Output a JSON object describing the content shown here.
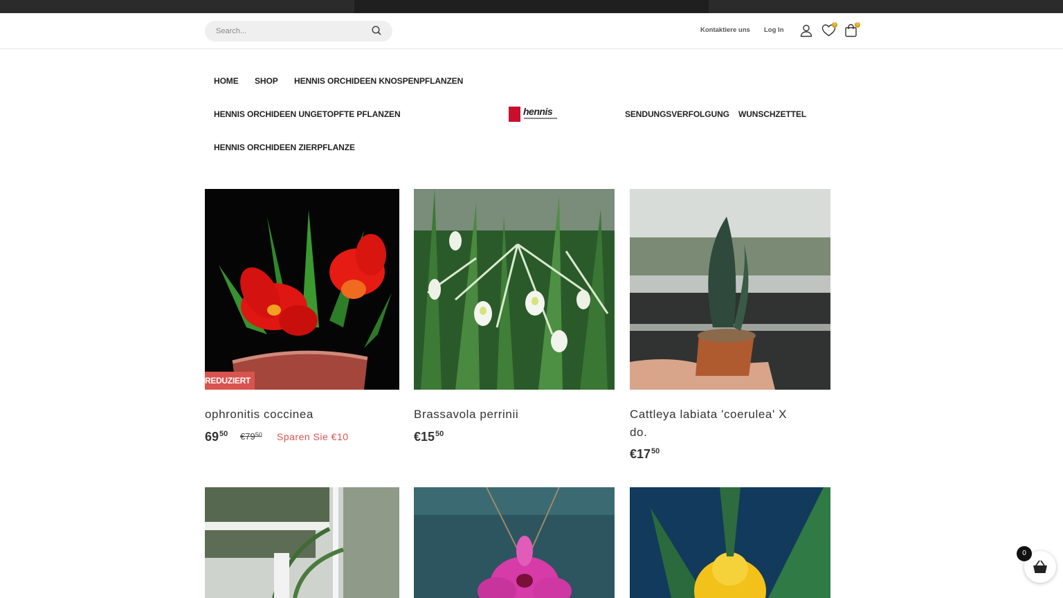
{
  "header": {
    "search_placeholder": "Search...",
    "contact_label": "Kontaktiere uns",
    "login_label": "Log In",
    "wishlist_count": "0",
    "cart_count": "0"
  },
  "nav": {
    "home": "HOME",
    "shop": "SHOP",
    "knospen": "HENNIS ORCHIDEEN KNOSPENPFLANZEN",
    "ungetopfte": "HENNIS ORCHIDEEN UNGETOPFTE PFLANZEN",
    "sendung": "SENDUNGSVERFOLGUNG",
    "wunsch": "WUNSCHZETTEL",
    "zier": "HENNIS ORCHIDEEN ZIERPFLANZE"
  },
  "logo": {
    "word": "hennis"
  },
  "products": [
    {
      "title": "ophronitis coccinea",
      "badge": "REDUZIERT",
      "price_main": "69",
      "price_cents": "50",
      "price_prefix": "€",
      "old_main": "€79",
      "old_cents": "50",
      "save_text": "Sparen Sie €10"
    },
    {
      "title": "Brassavola perrinii",
      "price_main": "€15",
      "price_cents": "50"
    },
    {
      "title_line1": "Cattleya labiata 'coerulea' X",
      "title_line2": "do.",
      "price_main": "€17",
      "price_cents": "50"
    }
  ],
  "floating_cart": {
    "count": "0"
  },
  "colors": {
    "accent": "#d9534f",
    "badge": "#d4a017",
    "brand_red": "#c8102e"
  },
  "icons": [
    "search-icon",
    "user-icon",
    "heart-icon",
    "bag-icon",
    "basket-icon"
  ]
}
